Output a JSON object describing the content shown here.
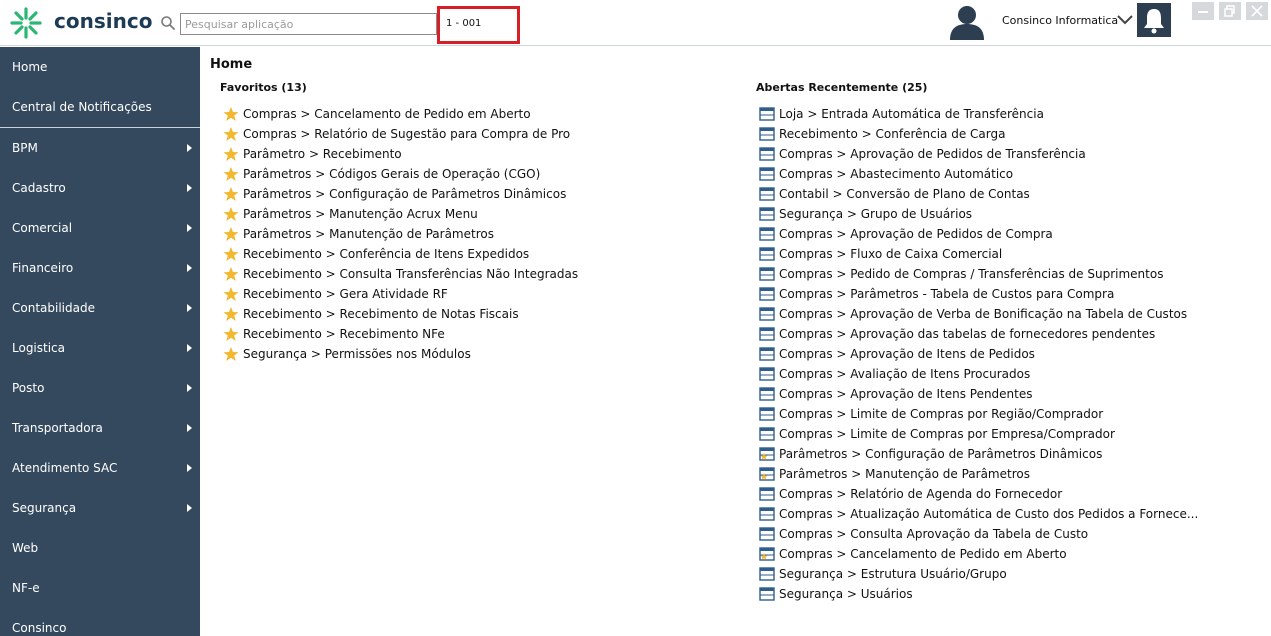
{
  "header": {
    "logo_text": "consinco",
    "search_placeholder": "Pesquisar aplicação",
    "company_code": "1 - 001",
    "user_name": "Consinco Informatica"
  },
  "sidebar": {
    "items": [
      {
        "label": "Home",
        "has_submenu": false
      },
      {
        "label": "Central de Notificações",
        "has_submenu": false
      },
      {
        "label": "BPM",
        "has_submenu": true
      },
      {
        "label": "Cadastro",
        "has_submenu": true
      },
      {
        "label": "Comercial",
        "has_submenu": true
      },
      {
        "label": "Financeiro",
        "has_submenu": true
      },
      {
        "label": "Contabilidade",
        "has_submenu": true
      },
      {
        "label": "Logistica",
        "has_submenu": true
      },
      {
        "label": "Posto",
        "has_submenu": true
      },
      {
        "label": "Transportadora",
        "has_submenu": true
      },
      {
        "label": "Atendimento SAC",
        "has_submenu": true
      },
      {
        "label": "Segurança",
        "has_submenu": true
      },
      {
        "label": "Web",
        "has_submenu": false
      },
      {
        "label": "NF-e",
        "has_submenu": false
      },
      {
        "label": "Consinco",
        "has_submenu": false
      }
    ]
  },
  "main": {
    "title": "Home",
    "favorites": {
      "title": "Favoritos (13)",
      "items": [
        "Compras > Cancelamento de Pedido em Aberto",
        "Compras > Relatório de Sugestão para Compra de Pro",
        "Parâmetro > Recebimento",
        "Parâmetros > Códigos Gerais de Operação (CGO)",
        "Parâmetros > Configuração de Parâmetros Dinâmicos",
        "Parâmetros > Manutenção Acrux Menu",
        "Parâmetros > Manutenção de Parâmetros",
        "Recebimento > Conferência de Itens Expedidos",
        "Recebimento > Consulta Transferências Não Integradas",
        "Recebimento > Gera Atividade RF",
        "Recebimento > Recebimento de Notas Fiscais",
        "Recebimento > Recebimento NFe",
        "Segurança > Permissões nos Módulos"
      ]
    },
    "recent": {
      "title": "Abertas Recentemente (25)",
      "items": [
        {
          "label": "Loja > Entrada Automática de Transferência",
          "starred": false
        },
        {
          "label": "Recebimento > Conferência de Carga",
          "starred": false
        },
        {
          "label": "Compras > Aprovação de Pedidos de Transferência",
          "starred": false
        },
        {
          "label": "Compras > Abastecimento Automático",
          "starred": false
        },
        {
          "label": "Contabil > Conversão de Plano de Contas",
          "starred": false
        },
        {
          "label": "Segurança > Grupo de Usuários",
          "starred": false
        },
        {
          "label": "Compras > Aprovação de Pedidos de Compra",
          "starred": false
        },
        {
          "label": "Compras > Fluxo de Caixa Comercial",
          "starred": false
        },
        {
          "label": "Compras > Pedido de Compras / Transferências de Suprimentos",
          "starred": false
        },
        {
          "label": "Compras > Parâmetros - Tabela de Custos para Compra",
          "starred": false
        },
        {
          "label": "Compras > Aprovação de Verba de Bonificação na Tabela de Custos",
          "starred": false
        },
        {
          "label": "Compras > Aprovação das tabelas de fornecedores pendentes",
          "starred": false
        },
        {
          "label": "Compras > Aprovação de Itens de Pedidos",
          "starred": false
        },
        {
          "label": "Compras > Avaliação de Itens Procurados",
          "starred": false
        },
        {
          "label": "Compras > Aprovação de Itens Pendentes",
          "starred": false
        },
        {
          "label": "Compras > Limite de Compras por Região/Comprador",
          "starred": false
        },
        {
          "label": "Compras > Limite de Compras por Empresa/Comprador",
          "starred": false
        },
        {
          "label": "Parâmetros > Configuração de Parâmetros Dinâmicos",
          "starred": true
        },
        {
          "label": "Parâmetros > Manutenção de Parâmetros",
          "starred": true
        },
        {
          "label": "Compras > Relatório de Agenda do Fornecedor",
          "starred": false
        },
        {
          "label": "Compras > Atualização Automática de Custo dos Pedidos a Fornece...",
          "starred": false
        },
        {
          "label": "Compras > Consulta Aprovação da Tabela de Custo",
          "starred": false
        },
        {
          "label": "Compras > Cancelamento de Pedido em Aberto",
          "starred": true
        },
        {
          "label": "Segurança > Estrutura Usuário/Grupo",
          "starred": false
        },
        {
          "label": "Segurança > Usuários",
          "starred": false
        }
      ]
    }
  },
  "colors": {
    "sidebar_bg": "#34495e",
    "logo_green": "#2bb673",
    "logo_text": "#1d3b55",
    "highlight_red": "#d61f26",
    "star": "#f2b830",
    "window_icon": "#2f5d8c"
  }
}
